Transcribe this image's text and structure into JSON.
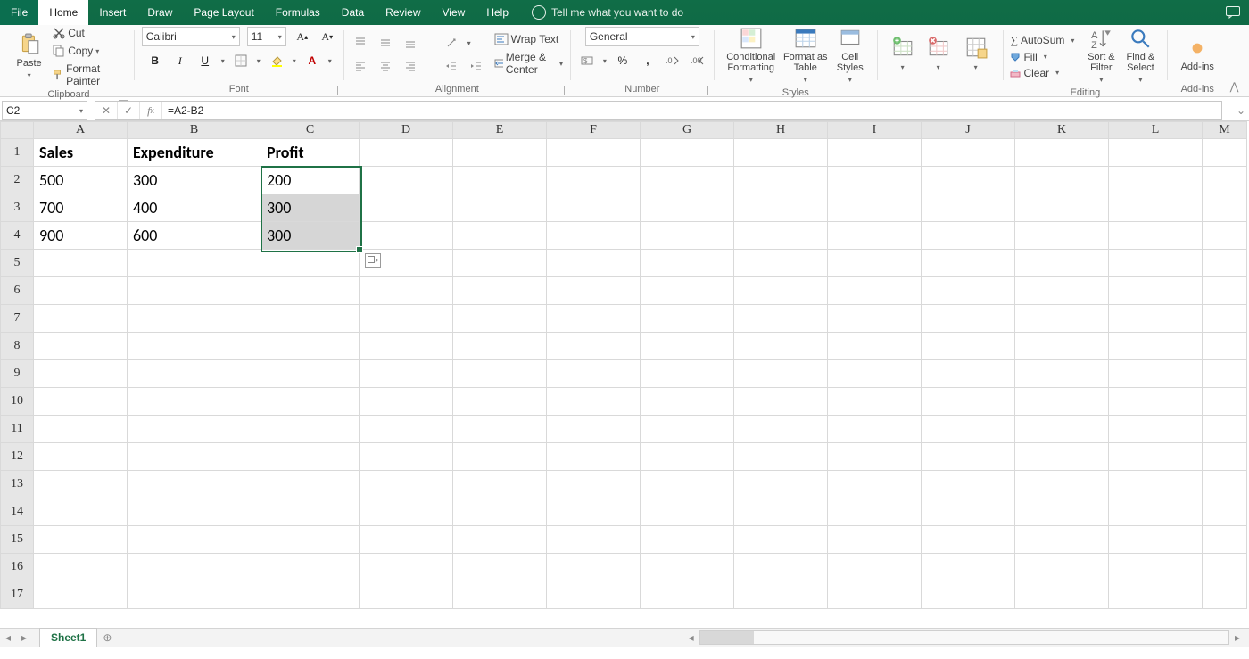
{
  "menu": {
    "file": "File",
    "home": "Home",
    "insert": "Insert",
    "draw": "Draw",
    "pagelayout": "Page Layout",
    "formulas": "Formulas",
    "data": "Data",
    "review": "Review",
    "view": "View",
    "help": "Help",
    "tellme": "Tell me what you want to do"
  },
  "clipboard": {
    "paste": "Paste",
    "cut": "Cut",
    "copy": "Copy",
    "formatpainter": "Format Painter",
    "label": "Clipboard"
  },
  "font": {
    "name": "Calibri",
    "size": "11",
    "label": "Font"
  },
  "alignment": {
    "wrap": "Wrap Text",
    "merge": "Merge & Center",
    "label": "Alignment"
  },
  "number": {
    "format": "General",
    "label": "Number"
  },
  "styles": {
    "cond": "Conditional Formatting",
    "table": "Format as Table",
    "cell": "Cell Styles",
    "label": "Styles"
  },
  "cells": {
    "A1": "Sales",
    "B1": "Expenditure",
    "C1": "Profit",
    "A2": "500",
    "B2": "300",
    "C2": "200",
    "A3": "700",
    "B3": "400",
    "C3": "300",
    "A4": "900",
    "B4": "600",
    "C4": "300"
  },
  "editing": {
    "autosum": "AutoSum",
    "fill": "Fill",
    "clear": "Clear",
    "sort": "Sort & Filter",
    "find": "Find & Select",
    "label": "Editing"
  },
  "addins": {
    "addins": "Add-ins",
    "label": "Add-ins"
  },
  "namebox": "C2",
  "formula": "=A2-B2",
  "columns": [
    "A",
    "B",
    "C",
    "D",
    "E",
    "F",
    "G",
    "H",
    "I",
    "J",
    "K",
    "L",
    "M"
  ],
  "rows": [
    "1",
    "2",
    "3",
    "4",
    "5",
    "6",
    "7",
    "8",
    "9",
    "10",
    "11",
    "12",
    "13",
    "14",
    "15",
    "16",
    "17"
  ],
  "selection": {
    "col": "C",
    "rowStart": 2,
    "rowEnd": 4,
    "activeRow": 2
  },
  "sheet": {
    "name": "Sheet1"
  }
}
